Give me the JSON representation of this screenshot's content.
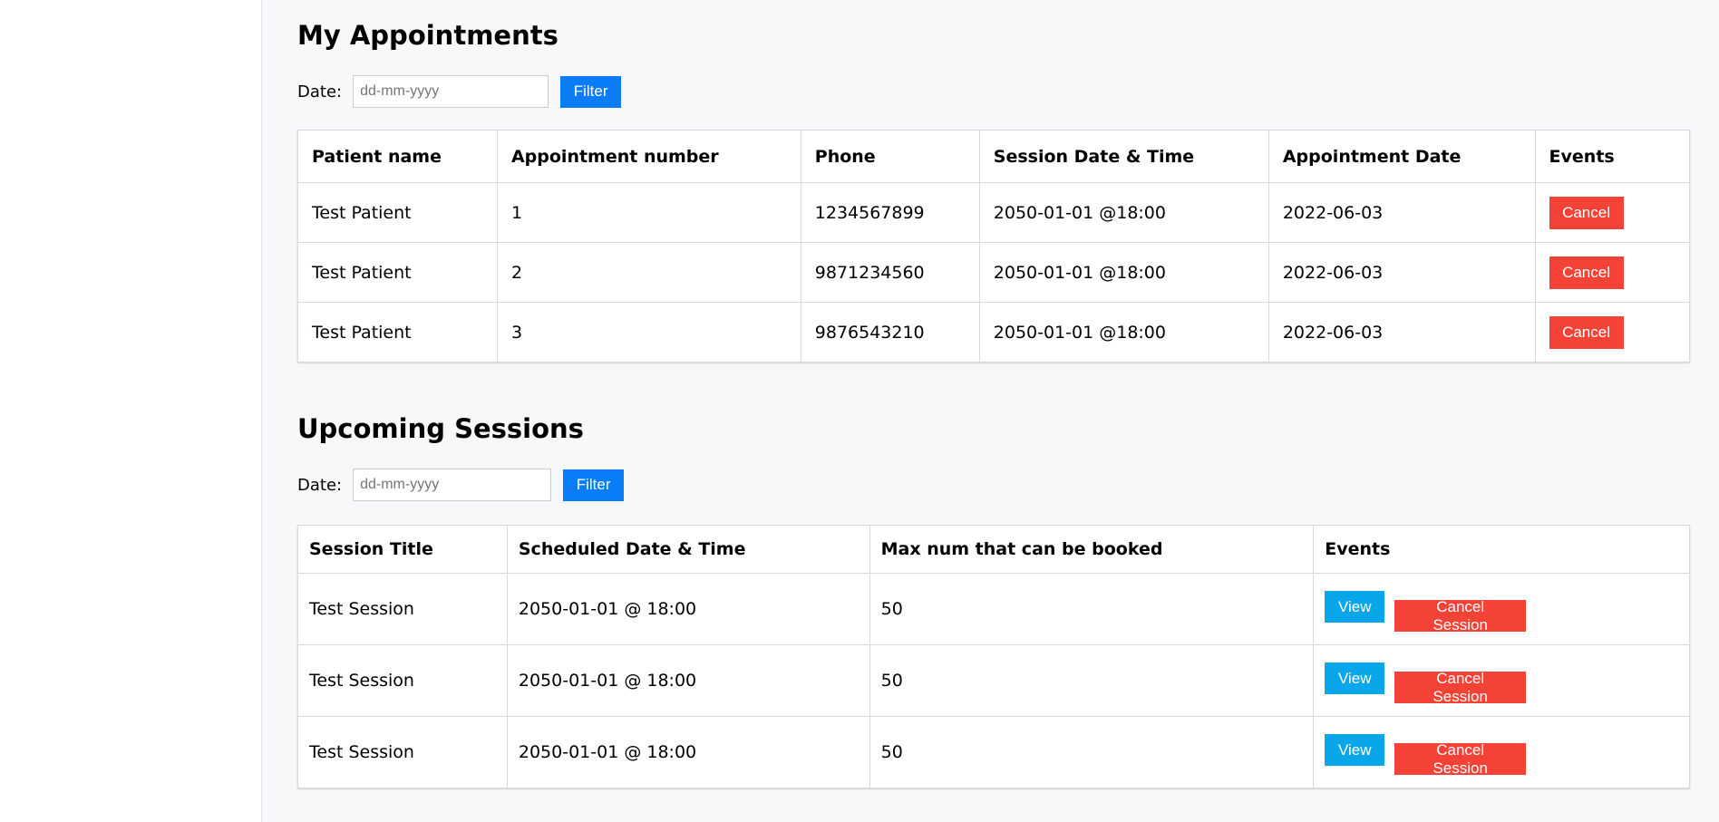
{
  "appointments": {
    "title": "My Appointments",
    "filter": {
      "label": "Date:",
      "placeholder": "dd-mm-yyyy",
      "button": "Filter"
    },
    "columns": [
      "Patient name",
      "Appointment number",
      "Phone",
      "Session Date & Time",
      "Appointment Date",
      "Events"
    ],
    "rows": [
      {
        "patient": "Test Patient",
        "number": "1",
        "phone": "1234567899",
        "session_datetime": "2050-01-01 @18:00",
        "appointment_date": "2022-06-03",
        "action": "Cancel"
      },
      {
        "patient": "Test Patient",
        "number": "2",
        "phone": "9871234560",
        "session_datetime": "2050-01-01 @18:00",
        "appointment_date": "2022-06-03",
        "action": "Cancel"
      },
      {
        "patient": "Test Patient",
        "number": "3",
        "phone": "9876543210",
        "session_datetime": "2050-01-01 @18:00",
        "appointment_date": "2022-06-03",
        "action": "Cancel"
      }
    ]
  },
  "sessions": {
    "title": "Upcoming Sessions",
    "filter": {
      "label": "Date:",
      "placeholder": "dd-mm-yyyy",
      "button": "Filter"
    },
    "columns": [
      "Session Title",
      "Scheduled Date & Time",
      "Max num that can be booked",
      "Events"
    ],
    "rows": [
      {
        "title": "Test Session",
        "scheduled": "2050-01-01 @ 18:00",
        "max": "50",
        "view": "View",
        "cancel": "Cancel Session"
      },
      {
        "title": "Test Session",
        "scheduled": "2050-01-01 @ 18:00",
        "max": "50",
        "view": "View",
        "cancel": "Cancel Session"
      },
      {
        "title": "Test Session",
        "scheduled": "2050-01-01 @ 18:00",
        "max": "50",
        "view": "View",
        "cancel": "Cancel Session"
      }
    ]
  },
  "colors": {
    "primary": "#0a7cf5",
    "danger": "#f44336",
    "info": "#0aa6ea",
    "background": "#f7f8fa"
  }
}
